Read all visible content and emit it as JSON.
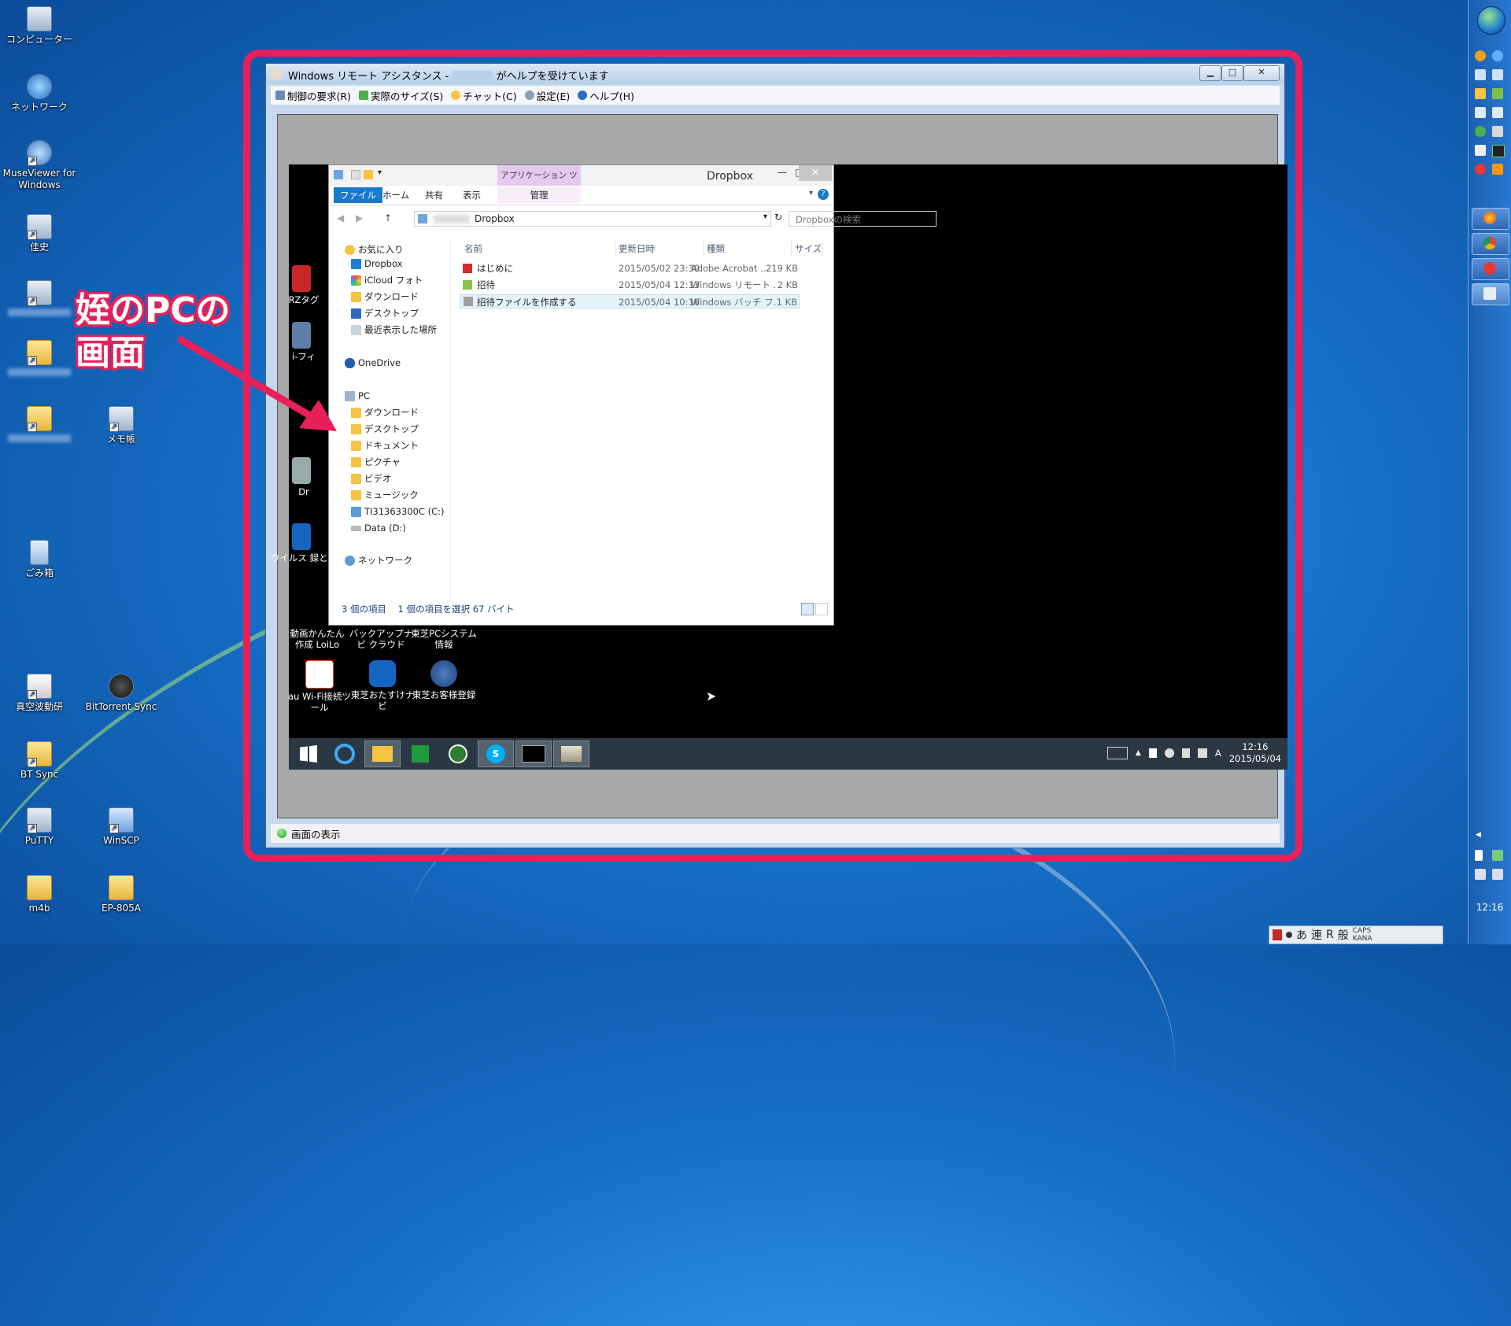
{
  "desktop": {
    "icons": [
      {
        "label": "コンピューター"
      },
      {
        "label": "ネットワーク"
      },
      {
        "label": "MuseViewer for Windows"
      },
      {
        "label": "佳史"
      },
      {
        "label": ""
      },
      {
        "label": ""
      },
      {
        "label": ""
      },
      {
        "label": "メモ帳"
      },
      {
        "label": "ごみ箱"
      },
      {
        "label": "真空波動研"
      },
      {
        "label": "BitTorrent Sync"
      },
      {
        "label": "BT Sync"
      },
      {
        "label": "PuTTY"
      },
      {
        "label": "WinSCP"
      },
      {
        "label": "m4b"
      },
      {
        "label": "EP-805A"
      }
    ]
  },
  "annotation": {
    "line1": "姪のPCの",
    "line2": "画面",
    "color": "#e8205a"
  },
  "ra": {
    "title_prefix": "Windows リモート アシスタンス - ",
    "title_suffix": " がヘルプを受けています",
    "menu": [
      "制御の要求(R)",
      "実際のサイズ(S)",
      "チャット(C)",
      "設定(E)",
      "ヘルプ(H)"
    ],
    "status": "画面の表示",
    "btn_min": "▁",
    "btn_max": "□",
    "btn_close": "✕"
  },
  "explorer": {
    "title": "Dropbox",
    "app_tools": "アプリケーション ツール",
    "tabs": [
      "ファイル",
      "ホーム",
      "共有",
      "表示",
      "管理"
    ],
    "path": "Dropbox",
    "search_placeholder": "Dropboxの検索",
    "nav": [
      "お気に入り",
      "Dropbox",
      "iCloud フォト",
      "ダウンロード",
      "デスクトップ",
      "最近表示した場所",
      "OneDrive",
      "PC",
      "ダウンロード",
      "デスクトップ",
      "ドキュメント",
      "ピクチャ",
      "ビデオ",
      "ミュージック",
      "TI31363300C (C:)",
      "Data (D:)",
      "ネットワーク"
    ],
    "columns": [
      "名前",
      "更新日時",
      "種類",
      "サイズ"
    ],
    "files": [
      {
        "name": "はじめに",
        "date": "2015/05/02 23:30",
        "type": "Adobe Acrobat ...",
        "size": "219 KB"
      },
      {
        "name": "招待",
        "date": "2015/05/04 12:13",
        "type": "Windows リモート ...",
        "size": "2 KB"
      },
      {
        "name": "招待ファイルを作成する",
        "date": "2015/05/04 10:16",
        "type": "Windows バッチ フ...",
        "size": "1 KB"
      }
    ],
    "status_count": "3 個の項目",
    "status_sel": "1 個の項目を選択  67 バイト"
  },
  "remote": {
    "desk_left": [
      "RZタグ",
      "i-フィ",
      "Dr",
      "ウイルス 録とこ"
    ],
    "desk_row": [
      "動画かんたん作成 LoiLo",
      "バックアップナビ クラウド",
      "東芝PCシステム情報"
    ],
    "desk_icons": [
      "au Wi-Fi接続ツール",
      "東芝おたすけナビ",
      "東芝お客様登録"
    ],
    "time": "12:16",
    "date": "2015/05/04",
    "ime": "A"
  },
  "sidebar": {
    "time": "12:16"
  },
  "imebar": [
    "あ",
    "連",
    "R",
    "般"
  ]
}
